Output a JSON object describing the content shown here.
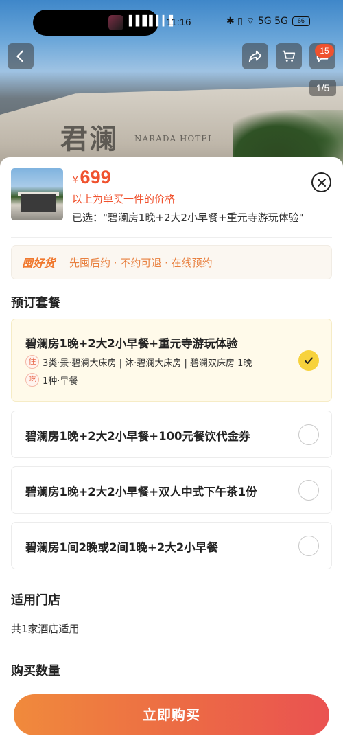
{
  "status_bar": {
    "time": "11:16",
    "wave": "▍▌▋▌▍▎▌",
    "icons": "✱ ▯ ⌔ 5G 5G",
    "battery": "66"
  },
  "hero": {
    "sign_text": "君澜",
    "sign_subtext": "NARADA HOTEL",
    "cart_badge": "15",
    "page_indicator": "1/5"
  },
  "sheet": {
    "currency": "¥",
    "price": "699",
    "price_note": "以上为单买一件的价格",
    "selected_text": "已选：\"碧澜房1晚+2大2小早餐+重元寺游玩体验\"",
    "promo": {
      "logo": "囤好货",
      "text": "先囤后约 · 不约可退 · 在线预约"
    },
    "package_section_title": "预订套餐",
    "packages": [
      {
        "name": "碧澜房1晚+2大2小早餐+重元寺游玩体验",
        "selected": true,
        "details": [
          {
            "tag": "住",
            "text": "3类·景·碧澜大床房 | 沐·碧澜大床房 | 碧澜双床房 1晚"
          },
          {
            "tag": "吃",
            "text": "1种·早餐"
          }
        ]
      },
      {
        "name": "碧澜房1晚+2大2小早餐+100元餐饮代金券",
        "selected": false
      },
      {
        "name": "碧澜房1晚+2大2小早餐+双人中式下午茶1份",
        "selected": false
      },
      {
        "name": "碧澜房1间2晚或2间1晚+2大2小早餐",
        "selected": false
      }
    ],
    "store_section_title": "适用门店",
    "store_text": "共1家酒店适用",
    "quantity_section_title": "购买数量",
    "buy_button": "立即购买"
  },
  "colors": {
    "accent": "#f0522e",
    "promo": "#e8803f",
    "check": "#f7d23c"
  }
}
